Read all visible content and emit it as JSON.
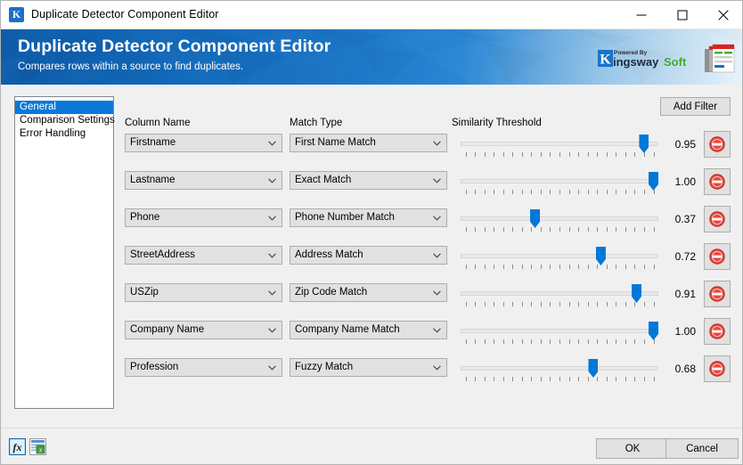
{
  "window": {
    "title": "Duplicate Detector Component Editor",
    "icon": "kingswaysoft-k-icon",
    "controls": {
      "minimize": "minimize-icon",
      "maximize": "maximize-icon",
      "close": "close-icon"
    }
  },
  "banner": {
    "title": "Duplicate Detector Component Editor",
    "subtitle": "Compares rows within a source to find duplicates.",
    "logo": {
      "powered_by": "Powered By",
      "k": "K",
      "brand1": "ingsway",
      "brand2": "Soft"
    }
  },
  "sidebar": {
    "items": [
      {
        "label": "General",
        "selected": true
      },
      {
        "label": "Comparison Settings",
        "selected": false
      },
      {
        "label": "Error Handling",
        "selected": false
      }
    ]
  },
  "toolbar": {
    "add_filter_label": "Add Filter"
  },
  "headers": {
    "column_name": "Column Name",
    "match_type": "Match Type",
    "similarity_threshold": "Similarity Threshold"
  },
  "rows": [
    {
      "column_name": "Firstname",
      "match_type": "First Name Match",
      "threshold": "0.95",
      "threshold_value": 0.95
    },
    {
      "column_name": "Lastname",
      "match_type": "Exact Match",
      "threshold": "1.00",
      "threshold_value": 1.0
    },
    {
      "column_name": "Phone",
      "match_type": "Phone Number Match",
      "threshold": "0.37",
      "threshold_value": 0.37
    },
    {
      "column_name": "StreetAddress",
      "match_type": "Address Match",
      "threshold": "0.72",
      "threshold_value": 0.72
    },
    {
      "column_name": "USZip",
      "match_type": "Zip Code Match",
      "threshold": "0.91",
      "threshold_value": 0.91
    },
    {
      "column_name": "Company Name",
      "match_type": "Company Name Match",
      "threshold": "1.00",
      "threshold_value": 1.0
    },
    {
      "column_name": "Profession",
      "match_type": "Fuzzy Match",
      "threshold": "0.68",
      "threshold_value": 0.68
    }
  ],
  "row_controls": {
    "remove_icon": "remove-circle-icon",
    "dropdown_icon": "chevron-down-icon"
  },
  "footer": {
    "expression_icon": "fx-expression-icon",
    "variables_icon": "variables-icon",
    "ok_label": "OK",
    "cancel_label": "Cancel"
  },
  "colors": {
    "accent_blue": "#0078d7",
    "banner_blue": "#1268b8",
    "selection_blue": "#0a78d7",
    "remove_red": "#e8483c",
    "brand_green": "#3fae29"
  }
}
